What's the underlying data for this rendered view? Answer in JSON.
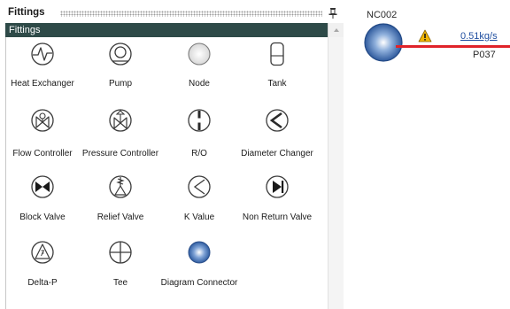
{
  "panel": {
    "title": "Fittings",
    "section_title": "Fittings"
  },
  "items": [
    {
      "label": "Heat Exchanger",
      "icon": "heat-exchanger-icon"
    },
    {
      "label": "Pump",
      "icon": "pump-icon"
    },
    {
      "label": "Node",
      "icon": "node-icon"
    },
    {
      "label": "Tank",
      "icon": "tank-icon"
    },
    {
      "label": "Flow Controller",
      "icon": "flow-controller-icon"
    },
    {
      "label": "Pressure Controller",
      "icon": "pressure-controller-icon"
    },
    {
      "label": "R/O",
      "icon": "restriction-orifice-icon"
    },
    {
      "label": "Diameter Changer",
      "icon": "diameter-changer-icon"
    },
    {
      "label": "Block Valve",
      "icon": "block-valve-icon"
    },
    {
      "label": "Relief Valve",
      "icon": "relief-valve-icon"
    },
    {
      "label": "K Value",
      "icon": "k-value-icon"
    },
    {
      "label": "Non Return Valve",
      "icon": "non-return-valve-icon"
    },
    {
      "label": "Delta-P",
      "icon": "delta-p-icon"
    },
    {
      "label": "Tee",
      "icon": "tee-icon"
    },
    {
      "label": "Diagram Connector",
      "icon": "diagram-connector-icon"
    }
  ],
  "diagram": {
    "node_name": "NC002",
    "pipe_flow": "0.51kg/s",
    "pipe_name": "P037",
    "warning_icon": "warning-icon",
    "pipe_color": "#e0232a"
  },
  "colors": {
    "section_header": "#2e4a48",
    "connector_blue": "#2f5fa8",
    "warning_yellow": "#f2b705"
  }
}
